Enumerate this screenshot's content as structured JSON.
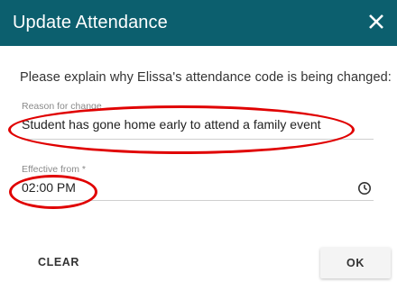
{
  "dialog": {
    "title": "Update Attendance",
    "close_icon": "close-icon"
  },
  "form": {
    "prompt": "Please explain why Elissa's attendance code is being changed:",
    "reason_label": "Reason for change",
    "reason_value": "Student has gone home early to attend a family event",
    "effective_label": "Effective from *",
    "effective_value": "02:00 PM",
    "clock_icon": "clock-icon"
  },
  "actions": {
    "clear_label": "CLEAR",
    "ok_label": "OK"
  },
  "colors": {
    "header": "#0c5f6e",
    "annotation": "#e00000"
  }
}
